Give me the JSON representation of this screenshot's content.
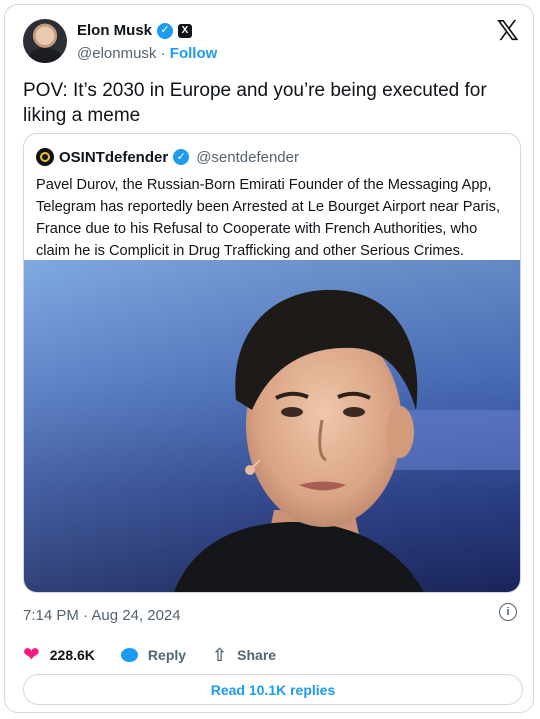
{
  "author": {
    "name": "Elon Musk",
    "handle": "@elonmusk",
    "separator": "·",
    "follow_label": "Follow",
    "verified_glyph": "✓",
    "affiliate_glyph": "X"
  },
  "brand_logo": "𝕏",
  "tweet": {
    "text": "POV: It’s 2030 in Europe and you’re being executed for liking a meme"
  },
  "quoted": {
    "name": "OSINTdefender",
    "handle": "@sentdefender",
    "verified_glyph": "✓",
    "text": "Pavel Durov, the Russian-Born Emirati Founder of the Messaging App, Telegram has reportedly been Arrested at Le Bourget Airport near Paris, France due to his Refusal to Cooperate with French Authorities, who claim he is Complicit in Drug Trafficking and other Serious Crimes."
  },
  "meta": {
    "timestamp": "7:14 PM · Aug 24, 2024",
    "info_glyph": "i"
  },
  "actions": {
    "likes": "228.6K",
    "reply_label": "Reply",
    "share_label": "Share",
    "heart_glyph": "❤",
    "share_glyph": "⇧"
  },
  "read_replies_label": "Read 10.1K replies",
  "colors": {
    "accent": "#1d9bf0",
    "like": "#f91880",
    "muted": "#536471",
    "text": "#0f1419",
    "border": "#cfd9de"
  },
  "icons": [
    "verified-badge-icon",
    "x-affiliate-icon",
    "x-logo-icon",
    "info-icon",
    "heart-icon",
    "reply-icon",
    "share-icon"
  ]
}
